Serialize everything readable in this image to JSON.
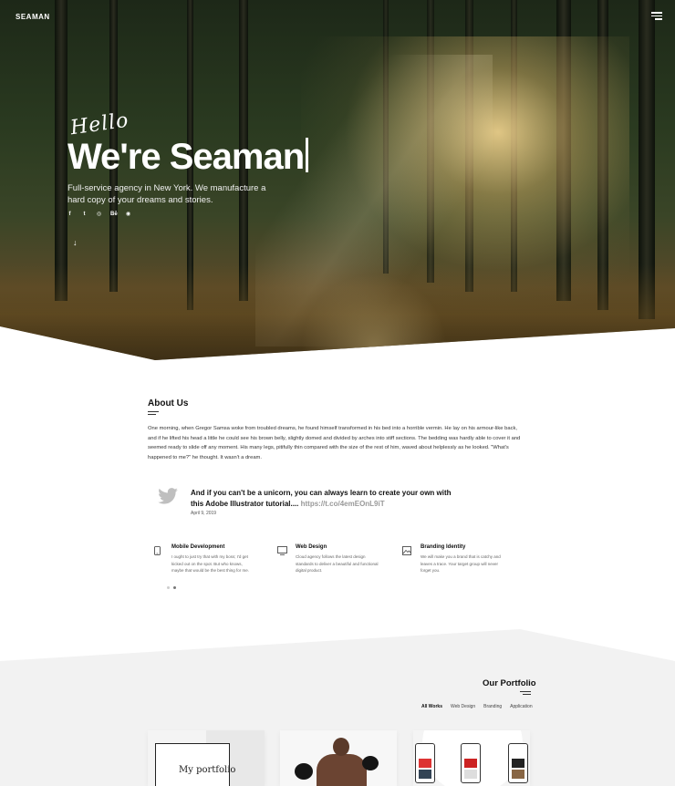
{
  "header": {
    "logo": "SEAMAN",
    "menu_icon": "hamburger-icon"
  },
  "hero": {
    "script_greeting": "Hello",
    "headline": "We're Seaman",
    "subtitle": "Full-service agency in New York. We manufacture a hard copy of your dreams and stories.",
    "social": [
      {
        "icon": "facebook-icon",
        "glyph": "f"
      },
      {
        "icon": "twitter-icon",
        "glyph": "t"
      },
      {
        "icon": "instagram-icon",
        "glyph": "◎"
      },
      {
        "icon": "behance-icon",
        "glyph": "Bē"
      },
      {
        "icon": "dribbble-icon",
        "glyph": "◉"
      }
    ],
    "scroll_icon": "arrow-down-icon",
    "scroll_glyph": "↓"
  },
  "about": {
    "title": "About Us",
    "text": "One morning, when Gregor Samsa woke from troubled dreams, he found himself transformed in his bed into a horrible vermin. He lay on his armour-like back, and if he lifted his head a little he could see his brown belly, slightly domed and divided by arches into stiff sections. The bedding was hardly able to cover it and seemed ready to slide off any moment. His many legs, pitifully thin compared with the size of the rest of him, waved about helplessly as he looked. \"What's happened to me?\" he thought. It wasn't a dream."
  },
  "tweet": {
    "text": "And if you can't be a unicorn, you can always learn to create your own with this Adobe Illustrator tutorial....",
    "link": "https://t.co/4emEOnL9iT",
    "date": "April 9, 2019"
  },
  "services": [
    {
      "icon": "mobile-icon",
      "title": "Mobile Development",
      "desc": "I ought to just try that with my boss; I'd get kicked out on the spot. But who knows, maybe that would be the best thing for me."
    },
    {
      "icon": "monitor-icon",
      "title": "Web Design",
      "desc": "Cloud agency follows the latest design standards to deliver a beautiful and functional digital product."
    },
    {
      "icon": "image-icon",
      "title": "Branding Identity",
      "desc": "We will make you a brand that is catchy and leaves a trace. Your target group will never forget you."
    }
  ],
  "portfolio": {
    "title": "Our Portfolio",
    "filters": [
      "All Works",
      "Web Design",
      "Branding",
      "Application"
    ],
    "active_filter": "All Works",
    "cards": [
      {
        "mock_title": "My portfolio"
      },
      {},
      {}
    ]
  },
  "colors": {
    "accent_dark": "#111111",
    "portfolio_bg": "#f2f2f2",
    "link_gray": "#999999"
  }
}
